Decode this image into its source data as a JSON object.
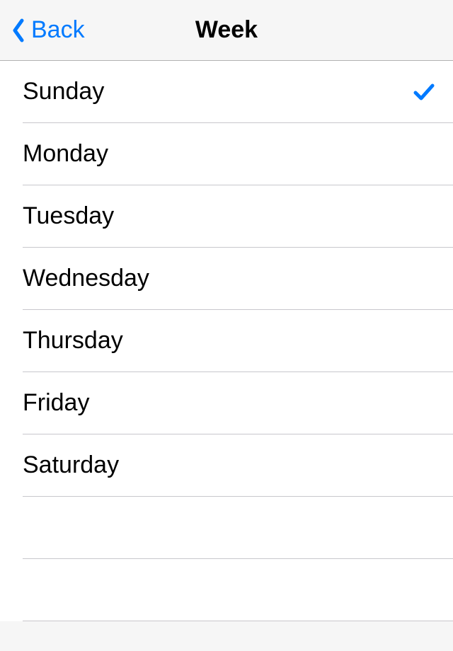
{
  "navbar": {
    "back_label": "Back",
    "title": "Week"
  },
  "list": {
    "items": [
      {
        "label": "Sunday",
        "selected": true
      },
      {
        "label": "Monday",
        "selected": false
      },
      {
        "label": "Tuesday",
        "selected": false
      },
      {
        "label": "Wednesday",
        "selected": false
      },
      {
        "label": "Thursday",
        "selected": false
      },
      {
        "label": "Friday",
        "selected": false
      },
      {
        "label": "Saturday",
        "selected": false
      },
      {
        "label": "",
        "selected": false
      },
      {
        "label": "",
        "selected": false
      }
    ]
  },
  "colors": {
    "accent": "#007aff"
  }
}
